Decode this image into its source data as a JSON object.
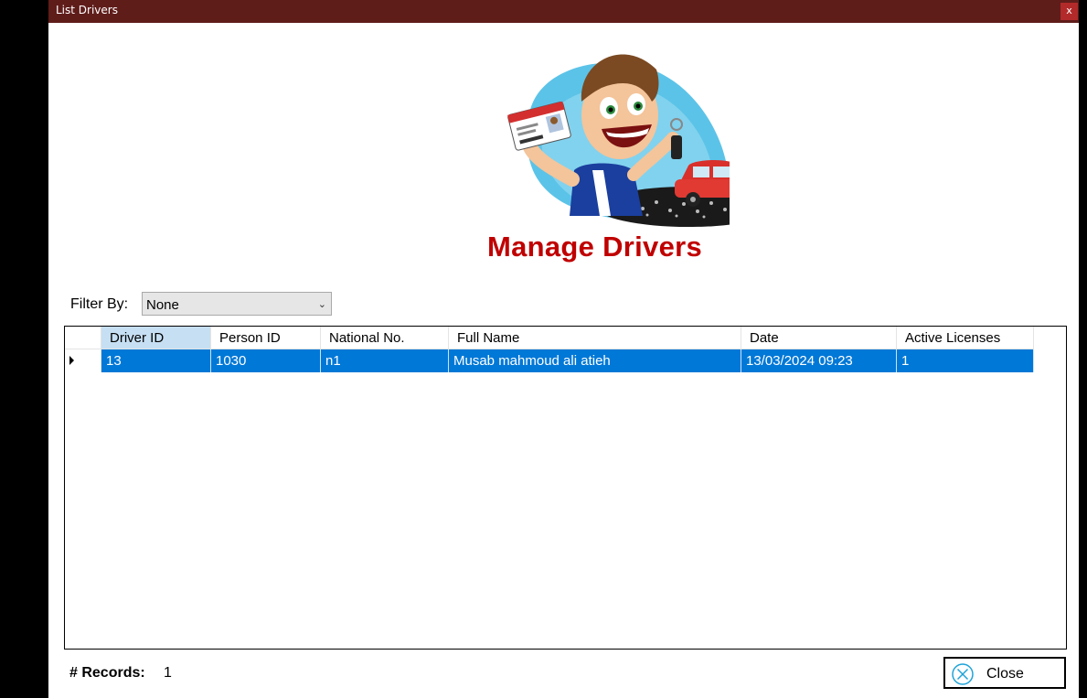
{
  "window": {
    "title": "List Drivers",
    "close_glyph": "x"
  },
  "header": {
    "title": "Manage Drivers",
    "logo_icon": "driver-with-license-and-car-logo"
  },
  "filter": {
    "label": "Filter By:",
    "selected": "None"
  },
  "table": {
    "columns": [
      "Driver ID",
      "Person ID",
      "National No.",
      "Full Name",
      "Date",
      "Active Licenses"
    ],
    "rows": [
      [
        "13",
        "1030",
        "n1",
        "Musab mahmoud ali atieh",
        "13/03/2024 09:23",
        "1"
      ]
    ]
  },
  "footer": {
    "records_label": "# Records:",
    "records_count": "1",
    "close_label": "Close"
  },
  "colors": {
    "titlebar": "#5f1d1a",
    "title_red": "#c00000",
    "selection_blue": "#0078d7",
    "header_selected": "#c6dff3"
  }
}
